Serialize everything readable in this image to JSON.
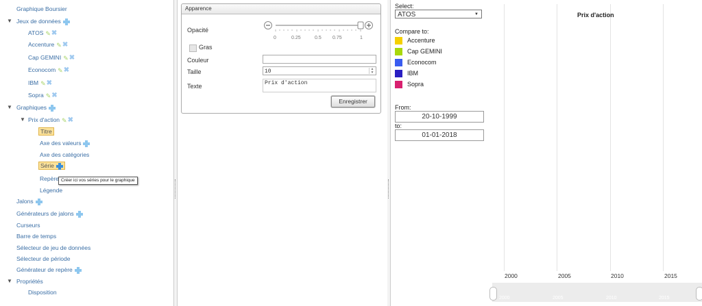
{
  "tree": {
    "graphique_boursier": "Graphique Boursier",
    "jeux_de_donnees": "Jeux de données",
    "datasets": [
      "ATOS",
      "Accenture",
      "Cap GEMINI",
      "Econocom",
      "IBM",
      "Sopra"
    ],
    "graphiques": "Graphiques",
    "prix_daction": "Prix d'action",
    "titre": "Titre",
    "axe_valeurs": "Axe des valeurs",
    "axe_categories": "Axe des catégories",
    "serie": "Série",
    "reperes": "Repères",
    "legende": "Légende",
    "jalons": "Jalons",
    "generateurs_jalons": "Générateurs de jalons",
    "curseurs": "Curseurs",
    "barre_temps": "Barre de temps",
    "selecteur_jeu": "Sélecteur de jeu de données",
    "selecteur_periode": "Sélecteur de période",
    "generateur_repere": "Générateur de repère",
    "proprietes": "Propriétés",
    "disposition": "Disposition",
    "tooltip": "Créer ici vos séries pour le graphique"
  },
  "form": {
    "section_title": "Apparence",
    "opacite_label": "Opacité",
    "opacite_value": 1,
    "slider_ticks": [
      "0",
      "0.25",
      "0.5",
      "0.75",
      "1"
    ],
    "gras_label": "Gras",
    "couleur_label": "Couleur",
    "couleur_value": "",
    "taille_label": "Taille",
    "taille_value": "10",
    "texte_label": "Texte",
    "texte_value": "Prix d'action",
    "save_label": "Enregistrer"
  },
  "preview": {
    "select_label": "Select:",
    "select_value": "ATOS",
    "compare_label": "Compare to:",
    "compare": [
      {
        "name": "Accenture",
        "color": "#f5d000"
      },
      {
        "name": "Cap GEMINI",
        "color": "#a8d80c"
      },
      {
        "name": "Econocom",
        "color": "#3a5cf0"
      },
      {
        "name": "IBM",
        "color": "#2a1fc2"
      },
      {
        "name": "Sopra",
        "color": "#d8206f"
      }
    ],
    "from_label": "From:",
    "from_value": "20-10-1999",
    "to_label": "to:",
    "to_value": "01-01-2018",
    "chart_title": "Prix d'action",
    "years": [
      "2000",
      "2005",
      "2010",
      "2015"
    ]
  }
}
